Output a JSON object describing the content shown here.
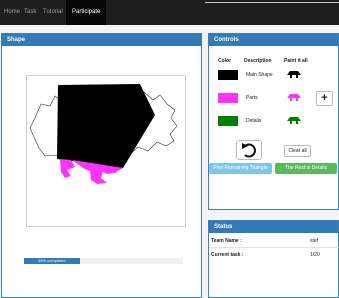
{
  "nav": {
    "items": [
      "Home",
      "Task",
      "Tutorial",
      "Participate"
    ],
    "active": "Participate"
  },
  "shape_panel": {
    "title": "Shape",
    "progress_label": "35% completed",
    "progress_fraction": 0.35
  },
  "controls": {
    "title": "Controls",
    "headers": {
      "color": "Color",
      "description": "Description",
      "paint": "Paint it all"
    },
    "rows": [
      {
        "color": "#000000",
        "description": "Main Shape"
      },
      {
        "color": "#ff33ff",
        "description": "Parts"
      },
      {
        "color": "#008000",
        "description": "Details"
      }
    ],
    "add_label": "+",
    "clear_label": "Clear all",
    "first_triangle_label": "First Remaining Triangle",
    "rest_details_label": "The Rest is Details"
  },
  "status": {
    "title": "Status",
    "team_label": "Team Name :",
    "team_value": "stef",
    "task_label": "Current task :",
    "task_value": "1/20"
  },
  "colors": {
    "accent": "#337ab7",
    "nav_bg": "#1e1e1e",
    "parts": "#ff33ff",
    "details": "#008000",
    "light_blue_button": "#7dc7e6",
    "green_button": "#5cb85c"
  }
}
